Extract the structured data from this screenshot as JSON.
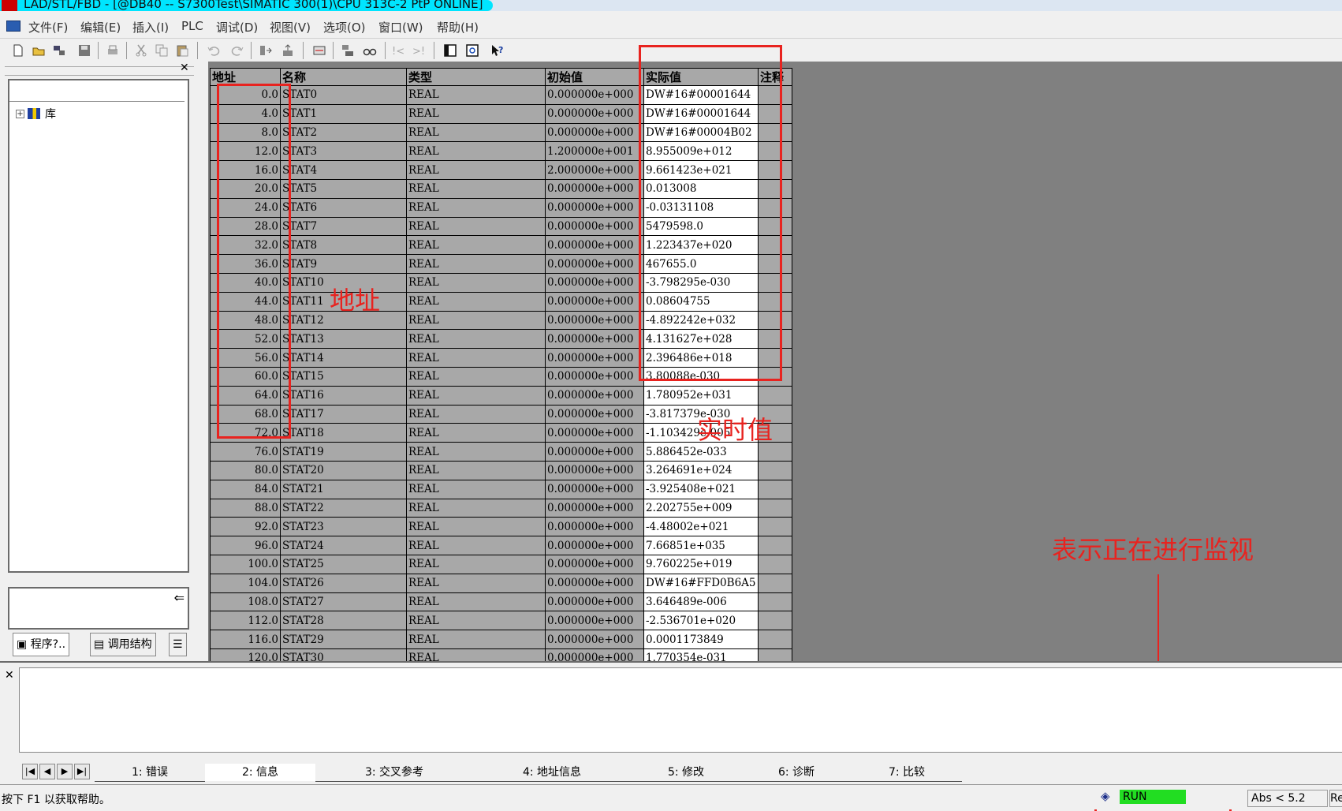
{
  "window": {
    "title": "LAD/STL/FBD  - [@DB40 -- S7300Test\\SIMATIC 300(1)\\CPU 313C-2 PtP  ONLINE]"
  },
  "menu": [
    "文件(F)",
    "编辑(E)",
    "插入(I)",
    "PLC",
    "调试(D)",
    "视图(V)",
    "选项(O)",
    "窗口(W)",
    "帮助(H)"
  ],
  "tree": {
    "root_label": "库"
  },
  "left_tabs": [
    "程序?..",
    "调用结构"
  ],
  "grid": {
    "headers": {
      "address": "地址",
      "name": "名称",
      "type": "类型",
      "initial": "初始值",
      "actual": "实际值",
      "comment": "注释"
    },
    "rows": [
      [
        "0.0",
        "STAT0",
        "REAL",
        "0.000000e+000",
        "DW#16#00001644"
      ],
      [
        "4.0",
        "STAT1",
        "REAL",
        "0.000000e+000",
        "DW#16#00001644"
      ],
      [
        "8.0",
        "STAT2",
        "REAL",
        "0.000000e+000",
        "DW#16#00004B02"
      ],
      [
        "12.0",
        "STAT3",
        "REAL",
        "1.200000e+001",
        "8.955009e+012"
      ],
      [
        "16.0",
        "STAT4",
        "REAL",
        "2.000000e+000",
        "9.661423e+021"
      ],
      [
        "20.0",
        "STAT5",
        "REAL",
        "0.000000e+000",
        "0.013008"
      ],
      [
        "24.0",
        "STAT6",
        "REAL",
        "0.000000e+000",
        "-0.03131108"
      ],
      [
        "28.0",
        "STAT7",
        "REAL",
        "0.000000e+000",
        "5479598.0"
      ],
      [
        "32.0",
        "STAT8",
        "REAL",
        "0.000000e+000",
        "1.223437e+020"
      ],
      [
        "36.0",
        "STAT9",
        "REAL",
        "0.000000e+000",
        "467655.0"
      ],
      [
        "40.0",
        "STAT10",
        "REAL",
        "0.000000e+000",
        "-3.798295e-030"
      ],
      [
        "44.0",
        "STAT11",
        "REAL",
        "0.000000e+000",
        "0.08604755"
      ],
      [
        "48.0",
        "STAT12",
        "REAL",
        "0.000000e+000",
        "-4.892242e+032"
      ],
      [
        "52.0",
        "STAT13",
        "REAL",
        "0.000000e+000",
        "4.131627e+028"
      ],
      [
        "56.0",
        "STAT14",
        "REAL",
        "0.000000e+000",
        "2.396486e+018"
      ],
      [
        "60.0",
        "STAT15",
        "REAL",
        "0.000000e+000",
        "3.80088e-030"
      ],
      [
        "64.0",
        "STAT16",
        "REAL",
        "0.000000e+000",
        "1.780952e+031"
      ],
      [
        "68.0",
        "STAT17",
        "REAL",
        "0.000000e+000",
        "-3.817379e-030"
      ],
      [
        "72.0",
        "STAT18",
        "REAL",
        "0.000000e+000",
        "-1.103429e-005"
      ],
      [
        "76.0",
        "STAT19",
        "REAL",
        "0.000000e+000",
        "5.886452e-033"
      ],
      [
        "80.0",
        "STAT20",
        "REAL",
        "0.000000e+000",
        "3.264691e+024"
      ],
      [
        "84.0",
        "STAT21",
        "REAL",
        "0.000000e+000",
        "-3.925408e+021"
      ],
      [
        "88.0",
        "STAT22",
        "REAL",
        "0.000000e+000",
        "2.202755e+009"
      ],
      [
        "92.0",
        "STAT23",
        "REAL",
        "0.000000e+000",
        "-4.48002e+021"
      ],
      [
        "96.0",
        "STAT24",
        "REAL",
        "0.000000e+000",
        "7.66851e+035"
      ],
      [
        "100.0",
        "STAT25",
        "REAL",
        "0.000000e+000",
        "9.760225e+019"
      ],
      [
        "104.0",
        "STAT26",
        "REAL",
        "0.000000e+000",
        "DW#16#FFD0B6A5"
      ],
      [
        "108.0",
        "STAT27",
        "REAL",
        "0.000000e+000",
        "3.646489e-006"
      ],
      [
        "112.0",
        "STAT28",
        "REAL",
        "0.000000e+000",
        "-2.536701e+020"
      ],
      [
        "116.0",
        "STAT29",
        "REAL",
        "0.000000e+000",
        "0.0001173849"
      ],
      [
        "120.0",
        "STAT30",
        "REAL",
        "0.000000e+000",
        "1.770354e-031"
      ]
    ]
  },
  "message_tabs": [
    "1: 错误",
    "2: 信息",
    "3: 交叉参考",
    "4: 地址信息",
    "5: 修改",
    "6: 诊断",
    "7: 比较"
  ],
  "status": {
    "help_text": "按下 F1 以获取帮助。",
    "run_state": "RUN",
    "abs": "Abs < 5.2",
    "extra": "Re"
  },
  "annotations": {
    "address_label": "地址",
    "actual_label": "实时值",
    "monitor_label": "表示正在进行监视"
  },
  "colors": {
    "annotation": "#e8231f",
    "run_indicator": "#22dd22",
    "title_highlight": "#00e5ff"
  }
}
